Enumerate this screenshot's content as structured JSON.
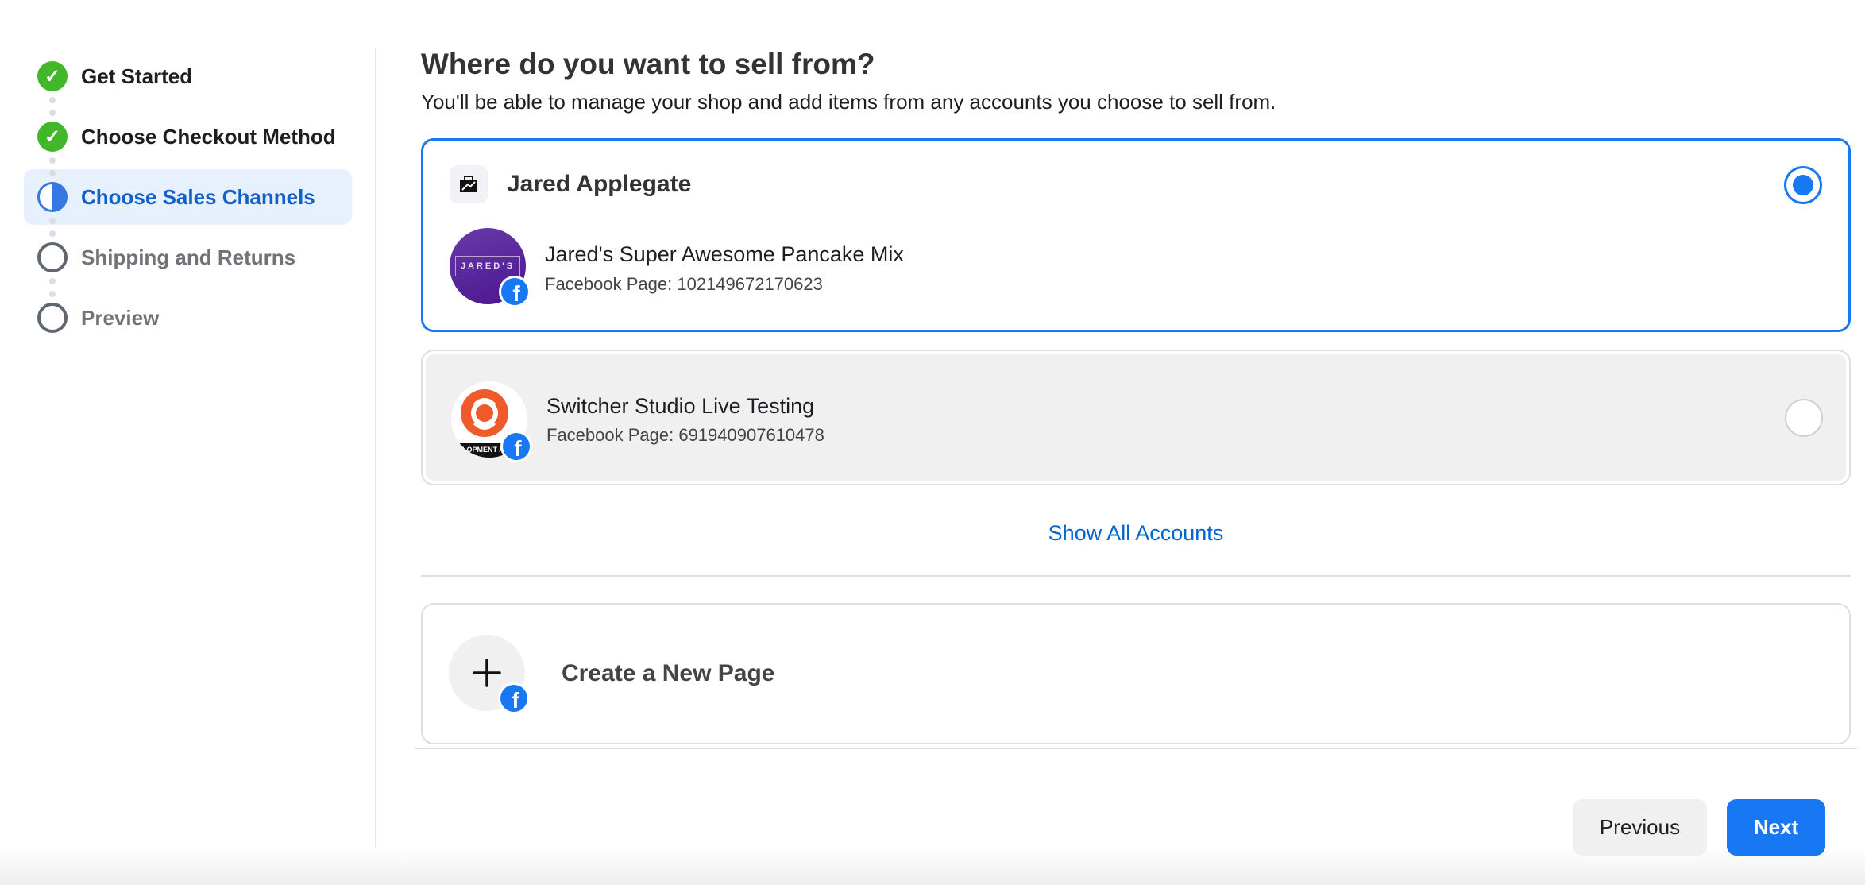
{
  "steps": [
    {
      "label": "Get Started",
      "status": "complete"
    },
    {
      "label": "Choose Checkout Method",
      "status": "complete"
    },
    {
      "label": "Choose Sales Channels",
      "status": "current"
    },
    {
      "label": "Shipping and Returns",
      "status": "pending"
    },
    {
      "label": "Preview",
      "status": "pending"
    }
  ],
  "main": {
    "title": "Where do you want to sell from?",
    "subtitle": "You'll be able to manage your shop and add items from any accounts you choose to sell from.",
    "accounts": [
      {
        "group": "Jared Applegate",
        "name": "Jared's Super Awesome Pancake Mix",
        "sub": "Facebook Page: 102149672170623",
        "selected": true,
        "avatar_text": "JARED'S"
      },
      {
        "name": "Switcher Studio Live Testing",
        "sub": "Facebook Page: 691940907610478",
        "selected": false,
        "avatar_text": "LOPMENT A"
      }
    ],
    "show_all": "Show All Accounts",
    "create_page": "Create a New Page",
    "previous": "Previous",
    "next": "Next"
  },
  "colors": {
    "accent": "#1877f2",
    "link": "#0064d1",
    "success": "#42b72a"
  }
}
